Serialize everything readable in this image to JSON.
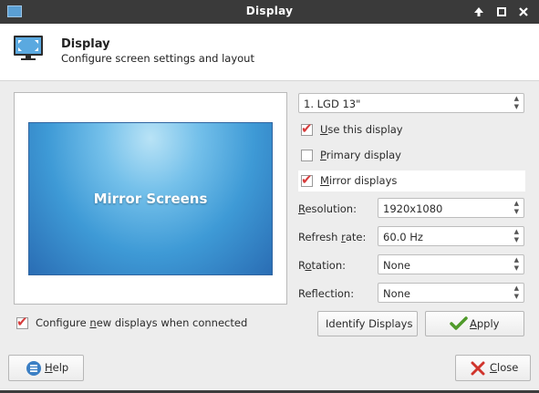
{
  "window": {
    "title": "Display",
    "controls": [
      "up-arrow-icon",
      "maximize-icon",
      "close-icon"
    ]
  },
  "header": {
    "title": "Display",
    "subtitle": "Configure screen settings and layout",
    "icon": "monitor-icon"
  },
  "preview": {
    "label": "Mirror Screens"
  },
  "display_select": {
    "value": "1. LGD 13\""
  },
  "options": {
    "use_display": {
      "label_pre": "",
      "mnemonic": "U",
      "label_post": "se this display",
      "checked": true
    },
    "primary_display": {
      "label_pre": "",
      "mnemonic": "P",
      "label_post": "rimary display",
      "checked": false
    },
    "mirror_displays": {
      "label_pre": "",
      "mnemonic": "M",
      "label_post": "irror displays",
      "checked": true
    },
    "configure_new": {
      "label_pre": "Configure ",
      "mnemonic": "n",
      "label_post": "ew displays when connected",
      "checked": true
    }
  },
  "fields": {
    "resolution": {
      "label_pre": "",
      "mnemonic": "R",
      "label_post": "esolution:",
      "value": "1920x1080"
    },
    "refresh_rate": {
      "label_pre": "Refresh ",
      "mnemonic": "r",
      "label_post": "ate:",
      "value": "60.0 Hz"
    },
    "rotation": {
      "label_pre": "R",
      "mnemonic": "o",
      "label_post": "tation:",
      "value": "None"
    },
    "reflection": {
      "label_pre": "Ref",
      "mnemonic": "l",
      "label_post": "ection:",
      "value": "None"
    }
  },
  "buttons": {
    "identify": "Identify Displays",
    "apply_pre": "",
    "apply_mnemonic": "A",
    "apply_post": "pply",
    "help_pre": "",
    "help_mnemonic": "H",
    "help_post": "elp",
    "close_pre": "",
    "close_mnemonic": "C",
    "close_post": "lose"
  },
  "colors": {
    "accent": "#3a8fd6",
    "checkmark": "#d63b3b",
    "apply_check": "#4f9a2a",
    "close_x": "#d0342c",
    "help_icon": "#3b7fc4"
  }
}
